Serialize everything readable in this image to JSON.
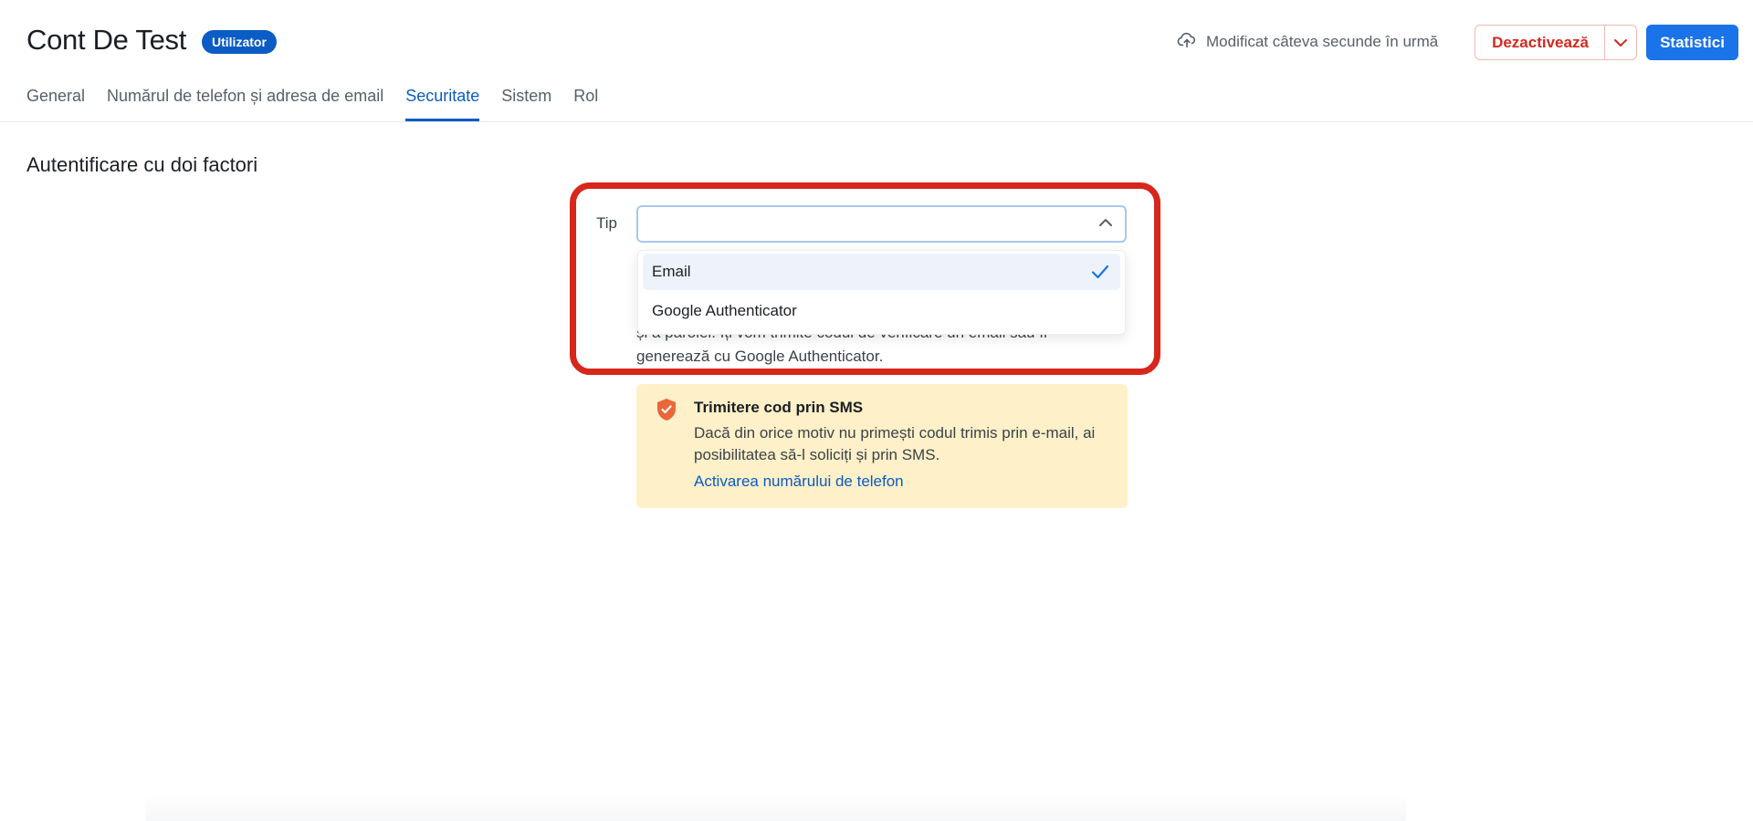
{
  "header": {
    "title": "Cont De Test",
    "role_badge": "Utilizator",
    "modified_status": "Modificat câteva secunde în urmă",
    "deactivate_label": "Dezactivează",
    "stats_label": "Statistici"
  },
  "tabs": [
    {
      "label": "General",
      "active": false
    },
    {
      "label": "Numărul de telefon și adresa de email",
      "active": false
    },
    {
      "label": "Securitate",
      "active": true
    },
    {
      "label": "Sistem",
      "active": false
    },
    {
      "label": "Rol",
      "active": false
    }
  ],
  "two_factor": {
    "section_title": "Autentificare cu doi factori",
    "field_label": "Tip",
    "selected_value": "",
    "options": [
      {
        "label": "Email",
        "selected": true
      },
      {
        "label": "Google Authenticator",
        "selected": false
      }
    ],
    "help_line1": "și a parolei. Îți vom trimite codul de verificare un email sau îl",
    "help_line2": "generează cu Google Authenticator."
  },
  "sms_notice": {
    "title": "Trimitere cod prin SMS",
    "body": "Dacă din orice motiv nu primești codul trimis prin e-mail, ai posibilitatea să-l soliciți și prin SMS.",
    "link": "Activarea numărului de telefon"
  },
  "colors": {
    "primary": "#1a73e8",
    "tab_active": "#0b5cc4",
    "danger": "#d12a1f",
    "highlight": "#d7261b",
    "notice_bg": "#fef0c8",
    "shield": "#e9673a"
  },
  "icons": {
    "modified": "cloud-upload-icon",
    "caret": "chevron-down-icon",
    "select": "chevron-up-icon",
    "check": "check-icon",
    "shield": "shield-check-icon"
  }
}
